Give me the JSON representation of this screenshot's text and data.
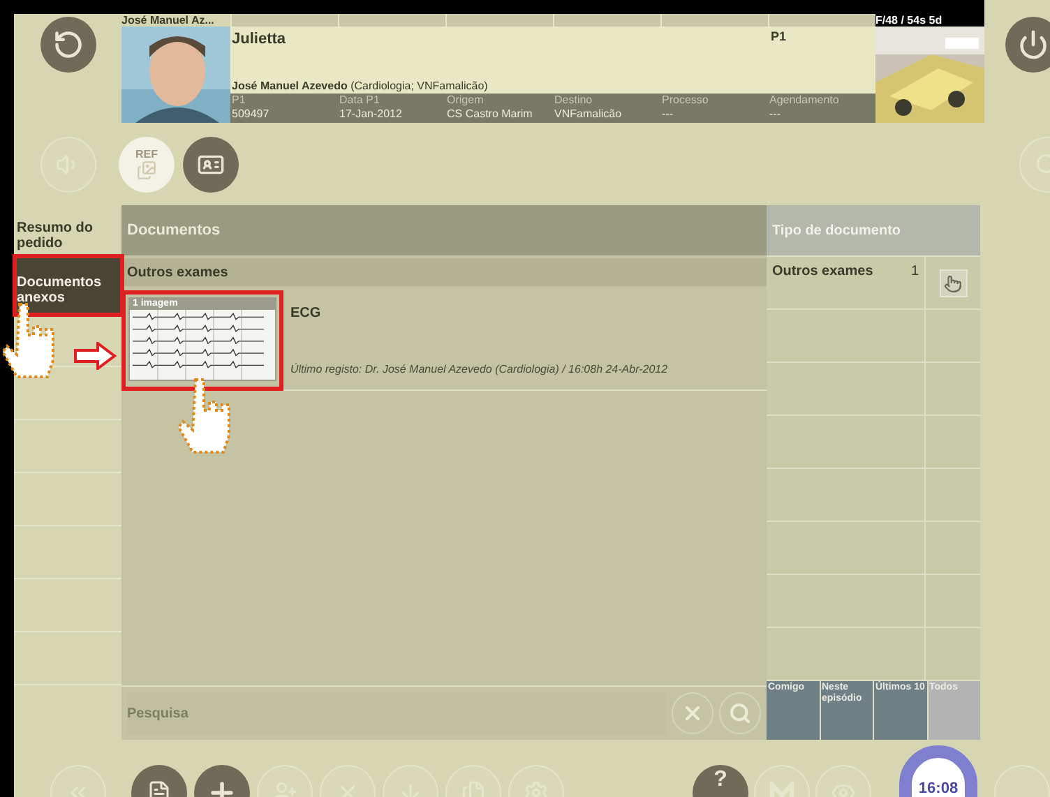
{
  "header": {
    "patient_tab": "José Manuel Az...",
    "name": "Julietta",
    "priority": "P1",
    "doctor_line": "**José Manuel Azevedo** (Cardiologia; VNFamalicão)",
    "fields": [
      {
        "label": "P1",
        "value": "509497"
      },
      {
        "label": "Data P1",
        "value": "17-Jan-2012"
      },
      {
        "label": "Origem",
        "value": "CS Castro Marim"
      },
      {
        "label": "Destino",
        "value": "VNFamalicão"
      },
      {
        "label": "Processo",
        "value": "---"
      },
      {
        "label": "Agendamento",
        "value": "---"
      }
    ],
    "photo_caption": "F/48 / 54s 5d"
  },
  "ref_button": {
    "label": "REF"
  },
  "sidebar": {
    "items": [
      {
        "label": "Resumo do pedido",
        "selected": false
      },
      {
        "label": "Documentos anexos",
        "selected": true
      }
    ]
  },
  "documents": {
    "title": "Documentos",
    "group": "Outros exames",
    "items": [
      {
        "thumb_label": "1 imagem",
        "title": "ECG",
        "last_record": "Último registo: Dr. José Manuel Azevedo (Cardiologia) / 16:08h 24-Abr-2012"
      }
    ],
    "search": {
      "placeholder": "Pesquisa"
    }
  },
  "doc_types": {
    "title": "Tipo de documento",
    "items": [
      {
        "label": "Outros exames",
        "count": "1"
      }
    ],
    "filters": [
      {
        "label": "Comigo",
        "selected": false
      },
      {
        "label": "Neste episódio",
        "selected": false
      },
      {
        "label": "Últimos 10",
        "selected": false
      },
      {
        "label": "Todos",
        "selected": true
      }
    ]
  },
  "toolbar": {
    "help": "?",
    "clock": "16:08"
  }
}
